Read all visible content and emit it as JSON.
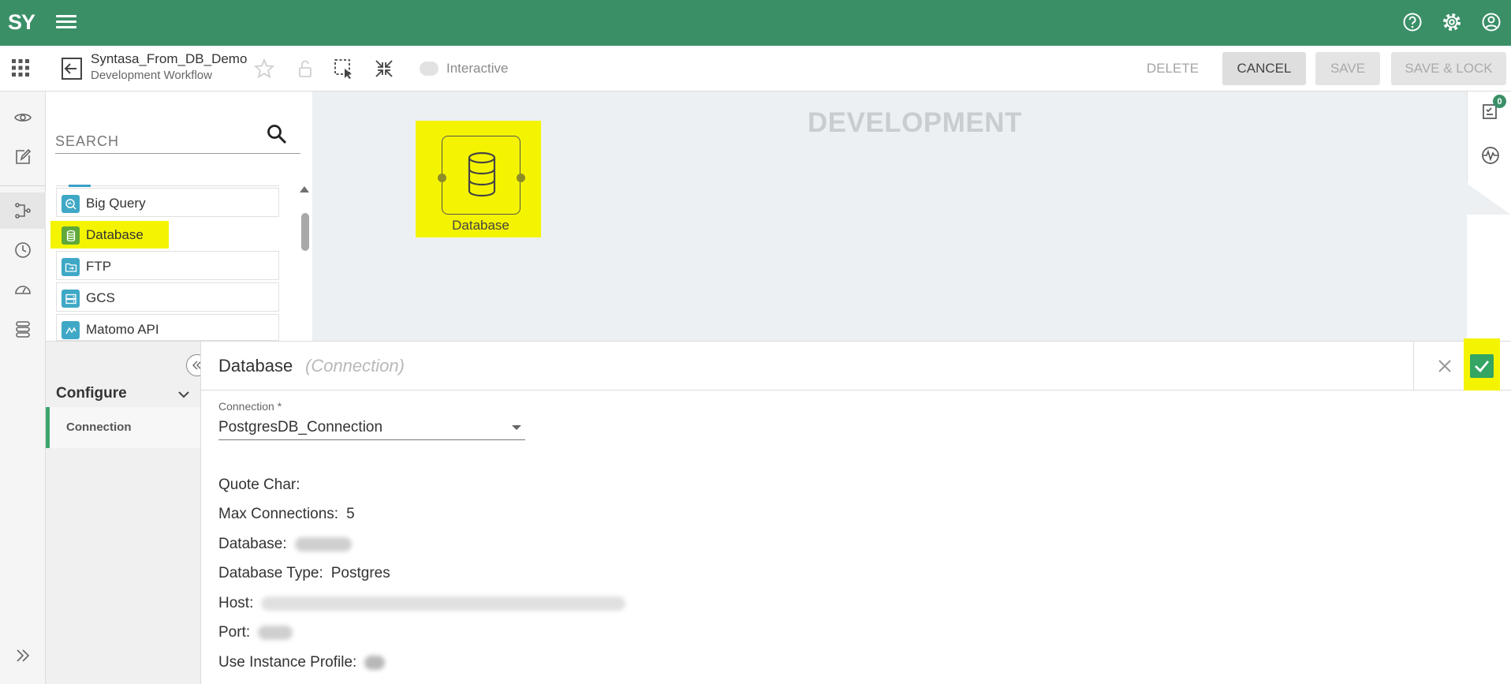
{
  "app": {
    "logo": "SY"
  },
  "toolbar": {
    "workflow_title": "Syntasa_From_DB_Demo",
    "workflow_subtitle": "Development Workflow",
    "interactive_label": "Interactive",
    "delete_label": "DELETE",
    "cancel_label": "CANCEL",
    "save_label": "SAVE",
    "save_lock_label": "SAVE & LOCK"
  },
  "palette": {
    "search_placeholder": "SEARCH",
    "items": [
      {
        "label": "Big Query",
        "icon": "bigquery-icon"
      },
      {
        "label": "Database",
        "icon": "database-icon",
        "highlighted": true
      },
      {
        "label": "FTP",
        "icon": "ftp-folder-icon"
      },
      {
        "label": "GCS",
        "icon": "gcs-icon"
      },
      {
        "label": "Matomo API",
        "icon": "matomo-icon"
      }
    ]
  },
  "canvas": {
    "environment_label": "DEVELOPMENT",
    "node": {
      "label": "Database",
      "icon": "database-icon"
    }
  },
  "right_rail": {
    "notification_count": "0"
  },
  "config": {
    "section_title": "Configure",
    "section_item": "Connection",
    "node_name": "Database",
    "node_type": "(Connection)",
    "connection_field_label": "Connection *",
    "connection_value": "PostgresDB_Connection",
    "properties": {
      "quote_char": {
        "label": "Quote Char:",
        "value": ""
      },
      "max_connections": {
        "label": "Max Connections:",
        "value": "5"
      },
      "database": {
        "label": "Database:",
        "value": "",
        "blurred": true
      },
      "database_type": {
        "label": "Database Type:",
        "value": "Postgres"
      },
      "host": {
        "label": "Host:",
        "value": "",
        "blurred": true
      },
      "port": {
        "label": "Port:",
        "value": "",
        "blurred": true
      },
      "use_instance_profile": {
        "label": "Use Instance Profile:",
        "value": "",
        "blurred": true
      }
    }
  },
  "colors": {
    "brand_green": "#3a8f67",
    "highlight_yellow": "#f4f400",
    "confirm_green": "#34a562",
    "palette_icon_blue": "#3fa8c6"
  }
}
